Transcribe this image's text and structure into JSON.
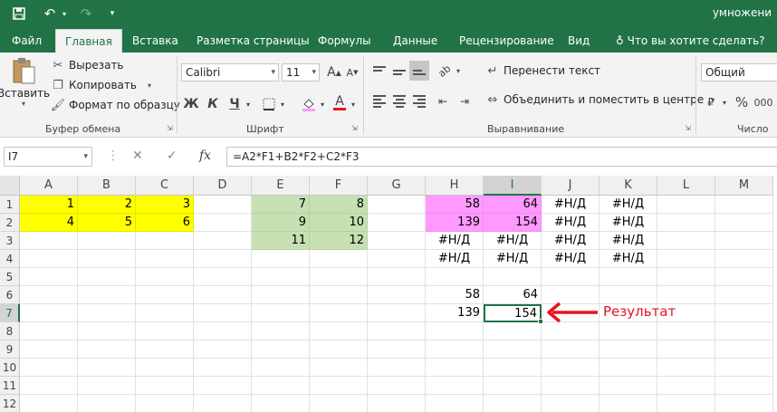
{
  "window": {
    "title": "умножени"
  },
  "ribbon_tabs": [
    "Файл",
    "Главная",
    "Вставка",
    "Разметка страницы",
    "Формулы",
    "Данные",
    "Рецензирование",
    "Вид"
  ],
  "tell_me": "Что вы хотите сделать?",
  "clipboard": {
    "paste": "Вставить",
    "cut": "Вырезать",
    "copy": "Копировать",
    "format_painter": "Формат по образцу",
    "label": "Буфер обмена"
  },
  "font": {
    "name": "Calibri",
    "size": "11",
    "bold": "Ж",
    "italic": "К",
    "underline": "Ч",
    "grow": "A",
    "shrink": "A",
    "font_color": "A",
    "label": "Шрифт"
  },
  "alignment": {
    "wrap": "Перенести текст",
    "merge": "Объединить и поместить в центре",
    "label": "Выравнивание"
  },
  "number": {
    "format": "Общий",
    "percent": "%",
    "label": "Число"
  },
  "formula_bar": {
    "name_box": "I7",
    "cancel": "✕",
    "enter": "✓",
    "fx": "fx",
    "formula": "=A2*F1+B2*F2+C2*F3"
  },
  "sheet": {
    "columns": [
      "A",
      "B",
      "C",
      "D",
      "E",
      "F",
      "G",
      "H",
      "I",
      "J",
      "K",
      "L",
      "M"
    ],
    "rows": [
      "1",
      "2",
      "3",
      "4",
      "5",
      "6",
      "7",
      "8",
      "9",
      "10",
      "11",
      "12"
    ],
    "cells": {
      "A1": "1",
      "B1": "2",
      "C1": "3",
      "A2": "4",
      "B2": "5",
      "C2": "6",
      "E1": "7",
      "F1": "8",
      "E2": "9",
      "F2": "10",
      "E3": "11",
      "F3": "12",
      "H1": "58",
      "I1": "64",
      "J1": "#Н/Д",
      "K1": "#Н/Д",
      "H2": "139",
      "I2": "154",
      "J2": "#Н/Д",
      "K2": "#Н/Д",
      "H3": "#Н/Д",
      "I3": "#Н/Д",
      "J3": "#Н/Д",
      "K3": "#Н/Д",
      "H4": "#Н/Д",
      "I4": "#Н/Д",
      "J4": "#Н/Д",
      "K4": "#Н/Д",
      "H6": "58",
      "I6": "64",
      "H7": "139",
      "I7": "154"
    },
    "active_cell": "I7",
    "colors": {
      "yellow": "#ffff00",
      "green": "#c6e0b4",
      "pink": "#ff99ff",
      "accent": "#217346"
    }
  },
  "annotation": {
    "text": "Результат",
    "color": "#e8141b"
  }
}
